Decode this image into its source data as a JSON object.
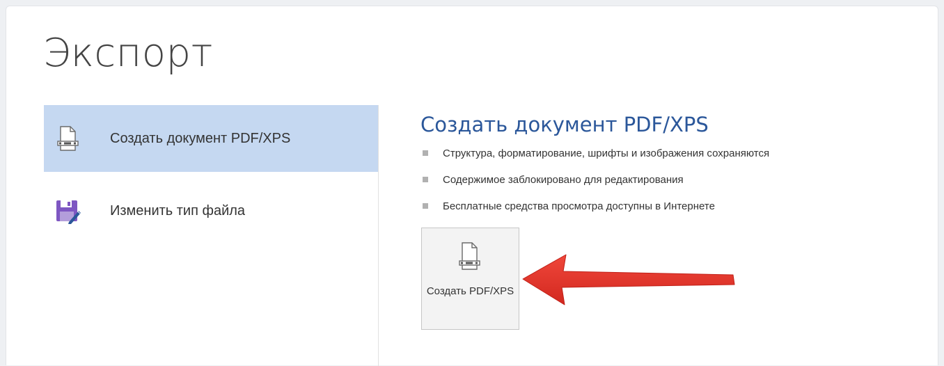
{
  "page": {
    "title": "Экспорт"
  },
  "left_list": {
    "items": [
      {
        "label": "Создать документ PDF/XPS",
        "icon": "pdf-document-icon",
        "selected": true
      },
      {
        "label": "Изменить тип файла",
        "icon": "save-as-edit-icon",
        "selected": false
      }
    ]
  },
  "detail": {
    "title": "Создать документ PDF/XPS",
    "bullets": [
      "Структура, форматирование, шрифты и изображения сохраняются",
      "Содержимое заблокировано для редактирования",
      "Бесплатные средства просмотра доступны в Интернете"
    ],
    "button": {
      "label": "Создать PDF/XPS",
      "icon": "pdf-document-icon"
    }
  },
  "annotation": {
    "arrow_icon": "red-arrow-icon",
    "arrow_color": "#e53a2f"
  },
  "colors": {
    "selected_bg": "#c5d8f1",
    "accent": "#2b579a",
    "save_icon": "#7e57c2"
  }
}
